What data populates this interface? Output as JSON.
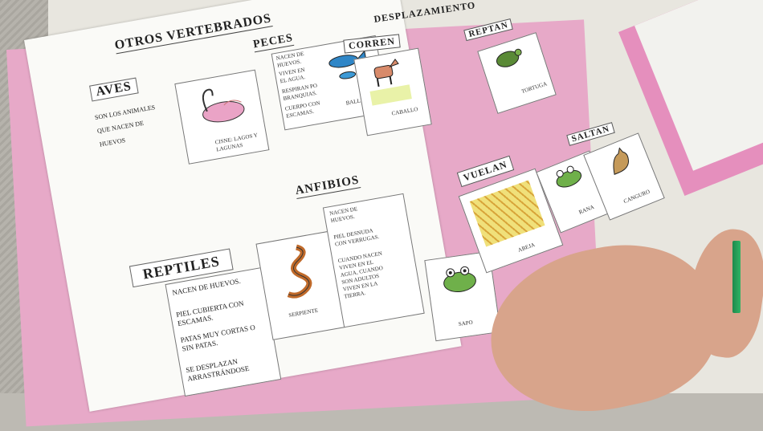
{
  "notebook": {
    "left_page": {
      "header": "OTROS VERTEBRADOS",
      "aves": {
        "title": "AVES",
        "text": "SON LOS ANIMALES QUE NACEN DE HUEVOS",
        "caption": "CISNE: LAGOS Y LAGUNAS"
      },
      "peces": {
        "title": "PECES",
        "traits": [
          "NACEN DE HUEVOS.",
          "VIVEN EN EL AGUA.",
          "RESPIRAN PO BRANQUIAS.",
          "CUERPO CON ESCAMAS."
        ],
        "caption": "BALLENAS"
      },
      "reptiles": {
        "title": "REPTILES",
        "traits": [
          "NACEN DE HUEVOS.",
          "PIEL CUBIERTA CON ESCAMAS.",
          "PATAS MUY CORTAS O SIN PATAS.",
          "SE DESPLAZAN ARRASTRÁNDOSE"
        ],
        "caption": "SERPIENTE"
      },
      "anfibios": {
        "title": "ANFIBIOS",
        "traits": [
          "NACEN DE HUEVOS.",
          "PIEL DESNUDA CON VERRUGAS.",
          "CUANDO NACEN VIVEN EN EL AGUA, CUANDO SON ADULTOS VIVEN EN LA TIERRA."
        ],
        "caption": "SAPO"
      }
    },
    "right_page": {
      "header": "DESPLAZAMIENTO",
      "groups": [
        {
          "title": "CORREN",
          "caption": "CABALLO"
        },
        {
          "title": "REPTAN",
          "caption": "TORTUGA"
        },
        {
          "title": "VUELAN",
          "caption": "ABEJA"
        },
        {
          "title": "SALTAN",
          "captions": [
            "RANA",
            "CANGURO"
          ]
        }
      ]
    }
  },
  "colors": {
    "cover": "#e7a9c8",
    "paper": "#fafaf7",
    "pencil": "#2fb365"
  }
}
